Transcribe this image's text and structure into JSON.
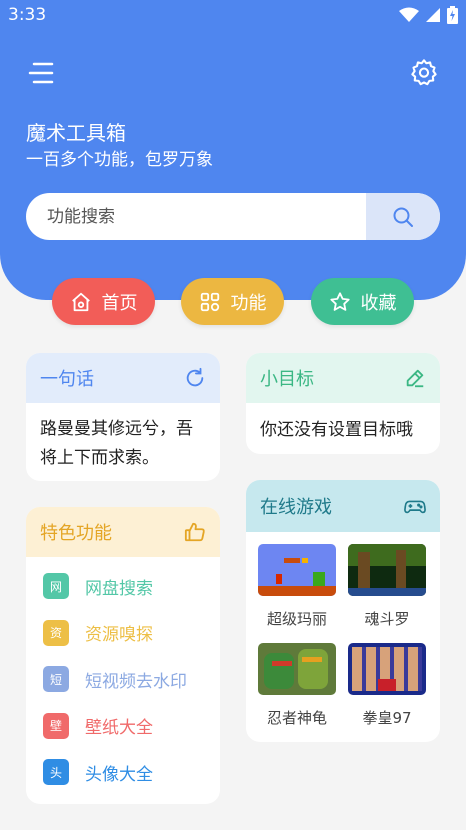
{
  "status_bar": {
    "time": "3:33"
  },
  "app": {
    "title": "魔术工具箱",
    "subtitle": "一百多个功能，包罗万象"
  },
  "search": {
    "placeholder": "功能搜索",
    "value": ""
  },
  "nav": [
    {
      "label": "首页",
      "icon": "home-icon",
      "color": "#f25d58"
    },
    {
      "label": "功能",
      "icon": "grid-icon",
      "color": "#ecb741"
    },
    {
      "label": "收藏",
      "icon": "star-icon",
      "color": "#3fbf93"
    }
  ],
  "quote_card": {
    "title": "一句话",
    "text": "路曼曼其修远兮，吾将上下而求索。",
    "icon": "refresh-icon"
  },
  "goal_card": {
    "title": "小目标",
    "text": "你还没有设置目标哦",
    "icon": "edit-icon"
  },
  "feature_card": {
    "title": "特色功能",
    "icon": "thumbs-up-icon",
    "items": [
      {
        "badge": "网",
        "label": "网盘搜索",
        "color": "#53c7a7"
      },
      {
        "badge": "资",
        "label": "资源嗅探",
        "color": "#edbf46"
      },
      {
        "badge": "短",
        "label": "短视频去水印",
        "color": "#8ca9e2"
      },
      {
        "badge": "壁",
        "label": "壁纸大全",
        "color": "#f06a6a"
      },
      {
        "badge": "头",
        "label": "头像大全",
        "color": "#2f8de4"
      }
    ]
  },
  "games_card": {
    "title": "在线游戏",
    "icon": "gamepad-icon",
    "games": [
      {
        "name": "超级玛丽"
      },
      {
        "name": "魂斗罗"
      },
      {
        "name": "忍者神龟"
      },
      {
        "name": "拳皇97"
      }
    ]
  }
}
